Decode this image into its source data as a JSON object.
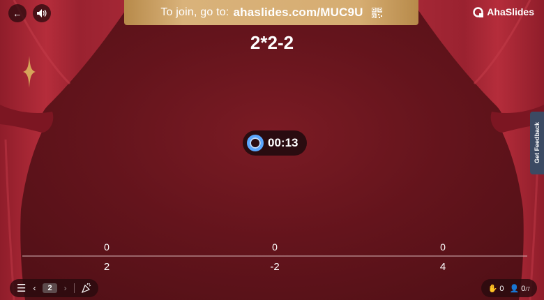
{
  "topbar": {
    "join_prefix": "To join, go to:",
    "join_url": "ahaslides.com/MUC9U",
    "brand": "AhaSlides"
  },
  "question": "2*2-2",
  "timer": "00:13",
  "feedback_tab": "Get Feedback",
  "chart_data": {
    "type": "bar",
    "categories": [
      "2",
      "-2",
      "4"
    ],
    "values": [
      0,
      0,
      0
    ],
    "title": "",
    "xlabel": "",
    "ylabel": ""
  },
  "bottom_bar": {
    "slide_number": "2"
  },
  "stats": {
    "reactions": "0",
    "participants": "0",
    "participants_total": "/7"
  },
  "colors": {
    "background": "#64141c",
    "curtain": "#9e2533",
    "banner": "#d6ad72",
    "timer_ring": "#5aa7ff"
  }
}
